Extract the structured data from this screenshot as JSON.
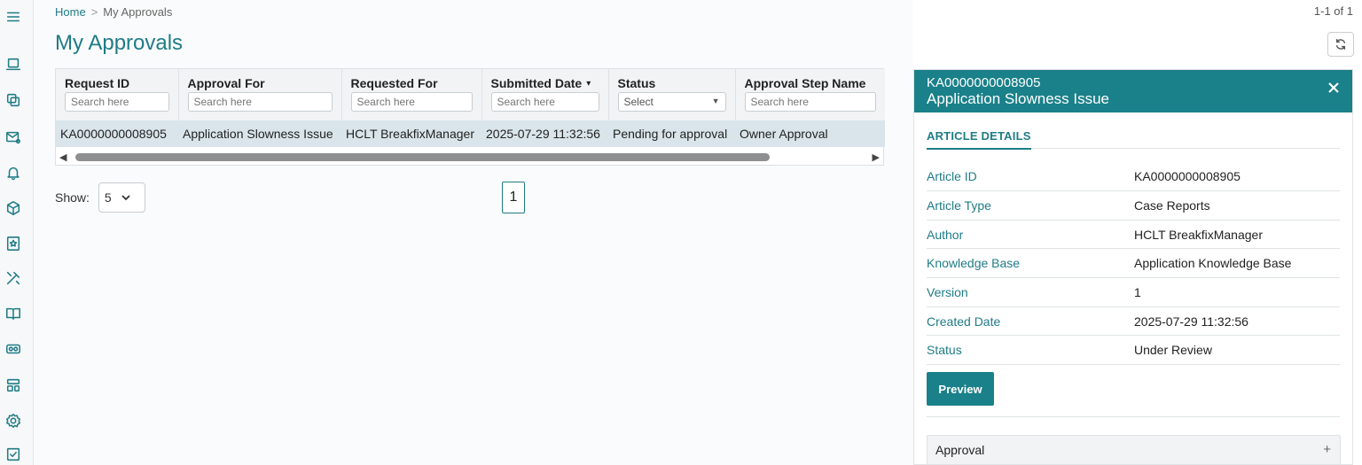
{
  "breadcrumb": {
    "home": "Home",
    "separator": ">",
    "current": "My Approvals"
  },
  "page": {
    "title": "My Approvals",
    "record_count": "1-1 of 1"
  },
  "grid": {
    "columns": [
      {
        "label": "Request ID",
        "filter_placeholder": "Search here"
      },
      {
        "label": "Approval For",
        "filter_placeholder": "Search here"
      },
      {
        "label": "Requested For",
        "filter_placeholder": "Search here"
      },
      {
        "label": "Submitted Date",
        "filter_placeholder": "Search here",
        "sort_indicator": "▾"
      },
      {
        "label": "Status",
        "filter_placeholder": "Select"
      },
      {
        "label": "Approval Step Name",
        "filter_placeholder": "Search here"
      }
    ],
    "rows": [
      [
        "KA0000000008905",
        "Application Slowness Issue",
        "HCLT BreakfixManager",
        "2025-07-29 11:32:56",
        "Pending for approval",
        "Owner Approval"
      ]
    ],
    "scroll_left": "◀",
    "scroll_right": "▶"
  },
  "pagination": {
    "show_label": "Show:",
    "page_size": "5",
    "current_page": "1"
  },
  "panel": {
    "record_id": "KA0000000008905",
    "title": "Application Slowness Issue",
    "tab": "ARTICLE DETAILS",
    "details": [
      {
        "label": "Article ID",
        "value": "KA0000000008905"
      },
      {
        "label": "Article Type",
        "value": "Case Reports"
      },
      {
        "label": "Author",
        "value": "HCLT BreakfixManager"
      },
      {
        "label": "Knowledge Base",
        "value": "Application Knowledge Base"
      },
      {
        "label": "Version",
        "value": "1"
      },
      {
        "label": "Created Date",
        "value": "2025-07-29 11:32:56"
      },
      {
        "label": "Status",
        "value": "Under Review"
      }
    ],
    "preview_button": "Preview",
    "accordion_label": "Approval",
    "accordion_icon": "+"
  },
  "sidebar": {
    "icons": [
      "menu-icon",
      "laptop-icon",
      "copy-icon",
      "mail-settings-icon",
      "bell-icon",
      "cube-icon",
      "bookmark-star-icon",
      "tools-icon",
      "book-icon",
      "vr-headset-icon",
      "layout-icon",
      "gear-icon",
      "checkbox-icon"
    ]
  },
  "colors": {
    "accent": "#1f7c86",
    "panel_header": "#1a8089",
    "selected_row": "#d9e5ea"
  }
}
